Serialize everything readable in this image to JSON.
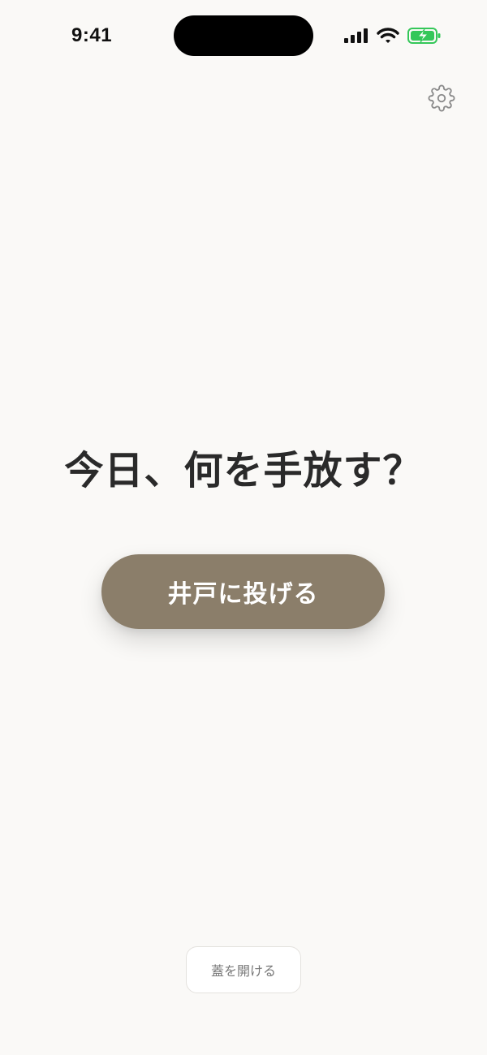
{
  "status_bar": {
    "time": "9:41",
    "icons": [
      "signal-icon",
      "wifi-icon",
      "battery-charging-icon"
    ],
    "battery_color": "#34c759"
  },
  "header": {
    "settings_icon": "gear-icon"
  },
  "main": {
    "prompt": "今日、何を手放す？",
    "primary_button_label": "井戸に投げる"
  },
  "footer": {
    "secondary_button_label": "蓋を開ける"
  },
  "colors": {
    "background": "#faf9f7",
    "primary_button": "#8b7e6a",
    "text": "#2a2a2a"
  }
}
